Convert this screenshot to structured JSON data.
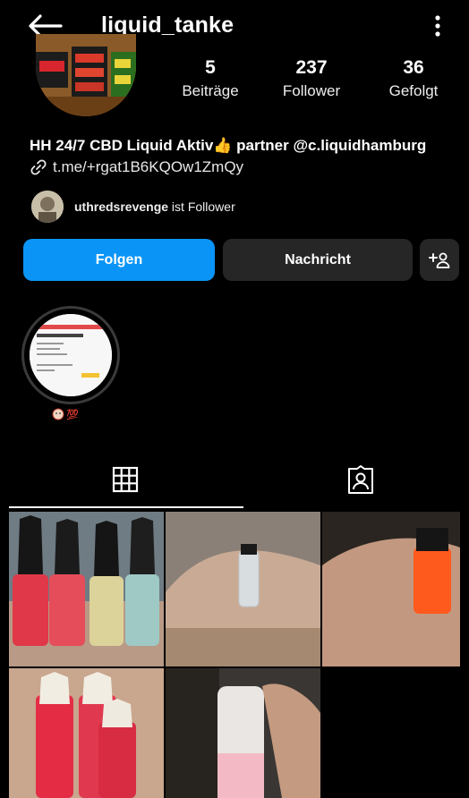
{
  "header": {
    "username": "liquid_tanke",
    "back_icon": "arrow-left-icon",
    "menu_icon": "more-vertical-icon"
  },
  "stats": [
    {
      "value": "5",
      "label": "Beiträge"
    },
    {
      "value": "237",
      "label": "Follower"
    },
    {
      "value": "36",
      "label": "Gefolgt"
    }
  ],
  "bio": {
    "text": "HH 24/7 CBD Liquid Aktiv👍 partner @c.liquidhamburg",
    "link": "t.me/+rgat1B6KQOw1ZmQy",
    "link_icon": "link-icon"
  },
  "mutual": {
    "username": "uthredsrevenge",
    "suffix": " ist Follower"
  },
  "buttons": {
    "follow": "Folgen",
    "message": "Nachricht",
    "add_icon": "add-person-icon"
  },
  "highlight": {
    "label": "💯"
  },
  "tabs": {
    "grid_icon": "grid-icon",
    "tagged_icon": "tagged-person-icon"
  },
  "colors": {
    "background": "#000000",
    "follow_button": "#0a95f6",
    "secondary_button": "#262626"
  }
}
